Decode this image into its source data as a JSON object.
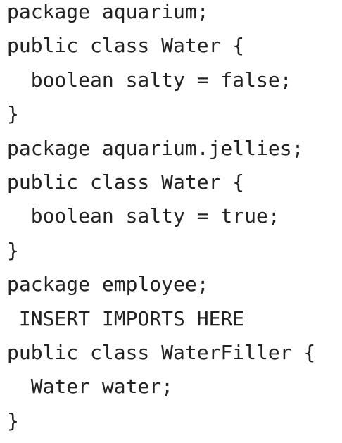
{
  "code": {
    "lines": [
      "package aquarium;",
      "public class Water {",
      "  boolean salty = false;",
      "}",
      "package aquarium.jellies;",
      "public class Water {",
      "  boolean salty = true;",
      "}",
      "package employee;",
      " INSERT IMPORTS HERE",
      "public class WaterFiller {",
      "  Water water;",
      "}"
    ]
  }
}
